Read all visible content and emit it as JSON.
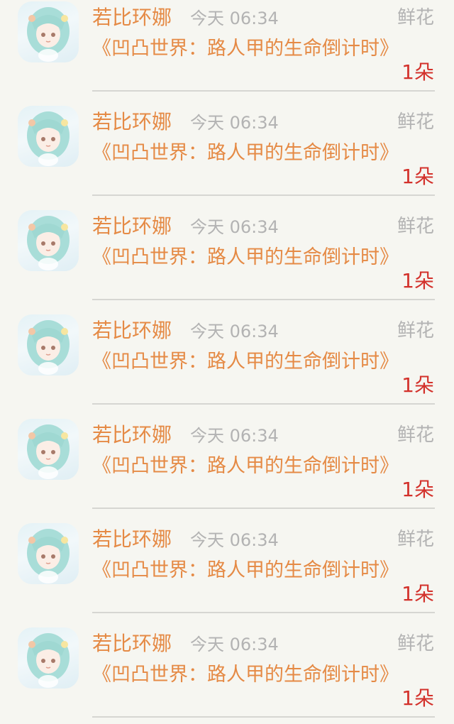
{
  "entries": [
    {
      "user": "若比环娜",
      "time": "今天 06:34",
      "gift": "鲜花",
      "book": "《凹凸世界：路人甲的生命倒计时》",
      "count": "1朵"
    },
    {
      "user": "若比环娜",
      "time": "今天 06:34",
      "gift": "鲜花",
      "book": "《凹凸世界：路人甲的生命倒计时》",
      "count": "1朵"
    },
    {
      "user": "若比环娜",
      "time": "今天 06:34",
      "gift": "鲜花",
      "book": "《凹凸世界：路人甲的生命倒计时》",
      "count": "1朵"
    },
    {
      "user": "若比环娜",
      "time": "今天 06:34",
      "gift": "鲜花",
      "book": "《凹凸世界：路人甲的生命倒计时》",
      "count": "1朵"
    },
    {
      "user": "若比环娜",
      "time": "今天 06:34",
      "gift": "鲜花",
      "book": "《凹凸世界：路人甲的生命倒计时》",
      "count": "1朵"
    },
    {
      "user": "若比环娜",
      "time": "今天 06:34",
      "gift": "鲜花",
      "book": "《凹凸世界：路人甲的生命倒计时》",
      "count": "1朵"
    },
    {
      "user": "若比环娜",
      "time": "今天 06:34",
      "gift": "鲜花",
      "book": "《凹凸世界：路人甲的生命倒计时》",
      "count": "1朵"
    }
  ],
  "colors": {
    "name_orange": "#e58a45",
    "count_red": "#d3312b",
    "muted_gray": "#b3b3b3",
    "background": "#f6f6f1"
  },
  "icons": {
    "avatar": "anime-girl-avatar-icon"
  }
}
